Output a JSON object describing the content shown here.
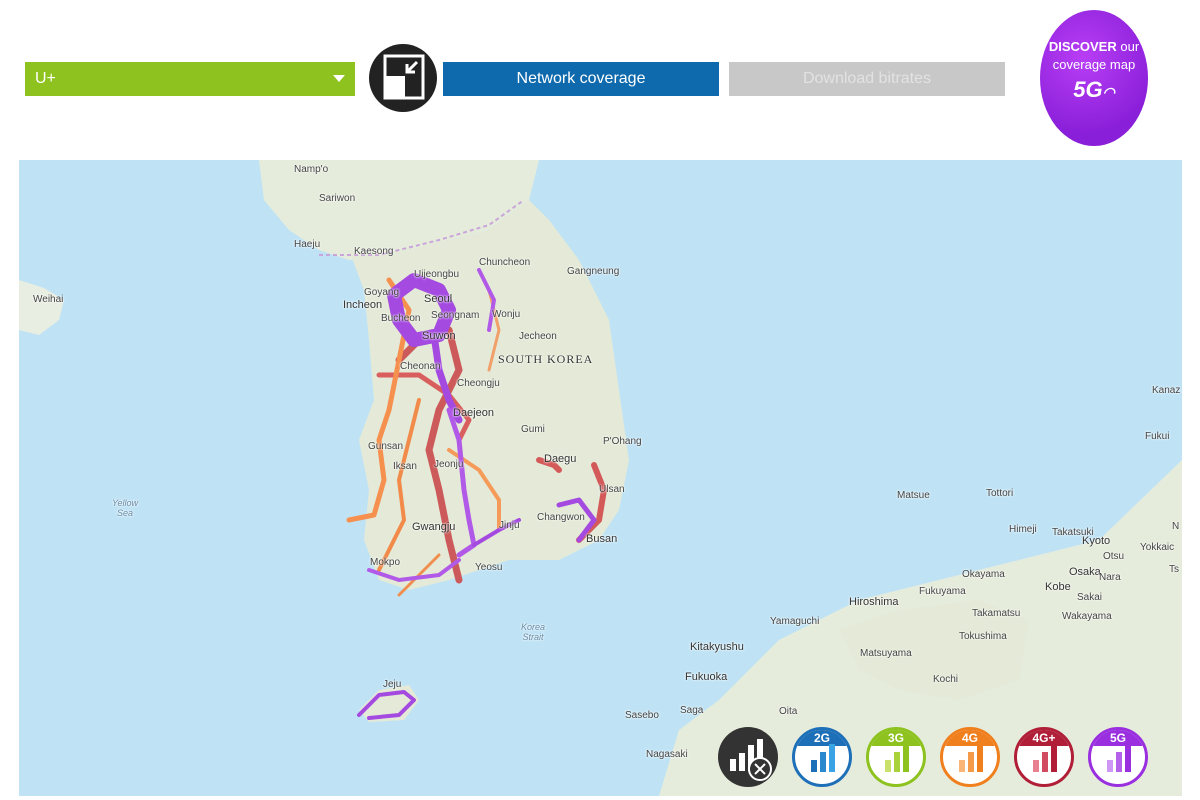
{
  "operator_select": {
    "value": "U+",
    "color": "#8dc21f"
  },
  "tabs": [
    {
      "label": "Network coverage",
      "active": true,
      "color": "#0e6aad"
    },
    {
      "label": "Download bitrates",
      "active": false,
      "color": "#c8c8c8",
      "text_color": "#e2e2e2"
    }
  ],
  "discover": {
    "bold": "DISCOVER",
    "rest": " our coverage map",
    "badge": "5G"
  },
  "map_labels": {
    "nampo": "Namp'o",
    "sariwon": "Sariwon",
    "haeju": "Haeju",
    "kaesong": "Kaesong",
    "weihai": "Weihai",
    "goyang": "Goyang",
    "uijeongbu": "Uijeongbu",
    "chuncheon": "Chuncheon",
    "gangneung": "Gangneung",
    "incheon": "Incheon",
    "seoul": "Seoul",
    "bucheon": "Bucheon",
    "seongnam": "Seongnam",
    "wonju": "Wonju",
    "suwon": "Suwon",
    "jecheon": "Jecheon",
    "south_korea": "SOUTH KOREA",
    "cheonan": "Cheonan",
    "cheongju": "Cheongju",
    "daejeon": "Daejeon",
    "gumi": "Gumi",
    "pohang": "P'Ohang",
    "gunsan": "Gunsan",
    "daegu": "Daegu",
    "iksan": "Iksan",
    "jeonju": "Jeonju",
    "ulsan": "Ulsan",
    "yellow_sea": "Yellow Sea",
    "gwangju": "Gwangju",
    "jinju": "Jinju",
    "changwon": "Changwon",
    "busan": "Busan",
    "mokpo": "Mokpo",
    "yeosu": "Yeosu",
    "korea_strait": "Korea Strait",
    "jeju": "Jeju",
    "kitakyushu": "Kitakyushu",
    "fukuoka": "Fukuoka",
    "sasebo": "Sasebo",
    "saga": "Saga",
    "oita": "Oita",
    "nagasaki": "Nagasaki",
    "yamaguchi": "Yamaguchi",
    "hiroshima": "Hiroshima",
    "matsuyama": "Matsuyama",
    "kochi": "Kochi",
    "tokushima": "Tokushima",
    "takamatsu": "Takamatsu",
    "fukuyama": "Fukuyama",
    "okayama": "Okayama",
    "himeji": "Himeji",
    "kobe": "Kobe",
    "sakai": "Sakai",
    "wakayama": "Wakayama",
    "osaka": "Osaka",
    "nara": "Nara",
    "takatsuki": "Takatsuki",
    "kyoto": "Kyoto",
    "otsu": "Otsu",
    "yokkaichi": "Yokkaic",
    "matsue": "Matsue",
    "tottori": "Tottori",
    "kanazawa": "Kanaz",
    "fukui": "Fukui",
    "ts": "Ts",
    "n": "N"
  },
  "network_buttons": [
    {
      "label": "2G",
      "color": "#1d6fb8",
      "bar_colors": [
        "#1d6fb8",
        "#2a88cf",
        "#39a3e6"
      ]
    },
    {
      "label": "3G",
      "color": "#8dc21f",
      "bar_colors": [
        "#c9e06a",
        "#a8d13a",
        "#8dc21f"
      ]
    },
    {
      "label": "4G",
      "color": "#f07f1e",
      "bar_colors": [
        "#f9b676",
        "#f59a48",
        "#f07f1e"
      ]
    },
    {
      "label": "4G+",
      "color": "#b01e38",
      "bar_colors": [
        "#e98090",
        "#d24a60",
        "#b01e38"
      ]
    },
    {
      "label": "5G",
      "color": "#9a2fe0",
      "bar_colors": [
        "#cf97f5",
        "#b562eb",
        "#9a2fe0"
      ]
    }
  ],
  "no_coverage_icon": "no-coverage-icon"
}
